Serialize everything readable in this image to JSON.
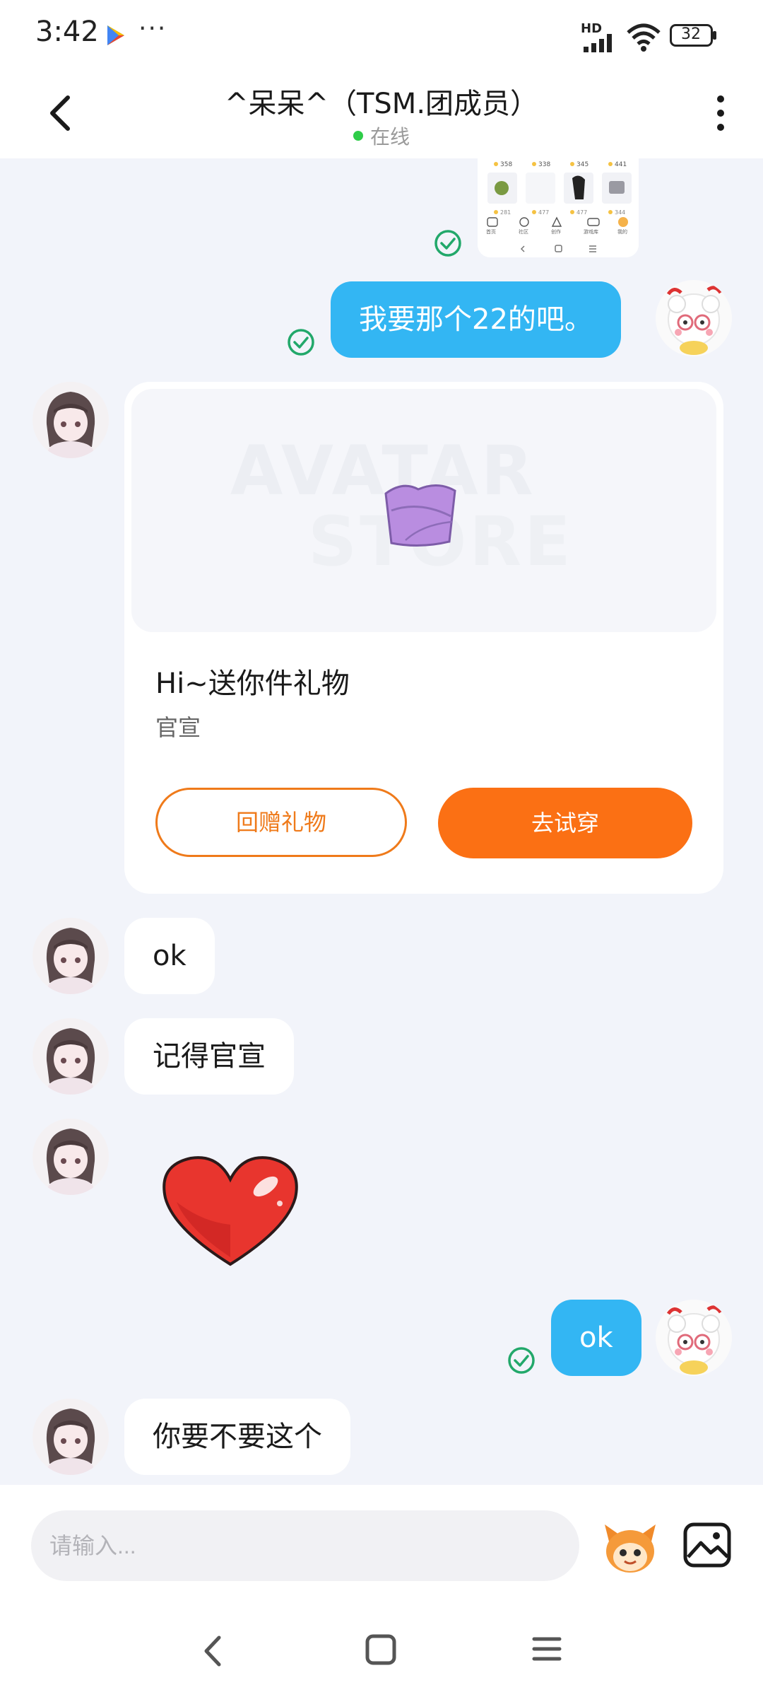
{
  "status_bar": {
    "time": "3:42",
    "more": "···",
    "network": "HD",
    "battery": "32"
  },
  "header": {
    "title": "^呆呆^（TSM.团成员）",
    "status": "在线"
  },
  "messages": {
    "out_1": "我要那个22的吧。",
    "in_ok": "ok",
    "in_remember": "记得官宣",
    "out_ok": "ok",
    "in_want": "你要不要这个"
  },
  "gift_card": {
    "watermark_line1": "AVATAR",
    "watermark_line2": "STORE",
    "title": "Hi~送你件礼物",
    "subtitle": "官宣",
    "return_button": "回赠礼物",
    "try_button": "去试穿"
  },
  "thumbnail": {
    "prices": [
      "358",
      "338",
      "345",
      "441"
    ],
    "prices_row2": [
      "281",
      "477",
      "477",
      "344"
    ],
    "tabs": [
      "首页",
      "社区",
      "创作",
      "游戏库",
      "我的"
    ]
  },
  "input": {
    "placeholder": "请输入..."
  },
  "colors": {
    "accent_orange": "#fb7014",
    "bubble_blue": "#33b6f3",
    "online_green": "#2ecc48",
    "check_green": "#22a86a"
  }
}
